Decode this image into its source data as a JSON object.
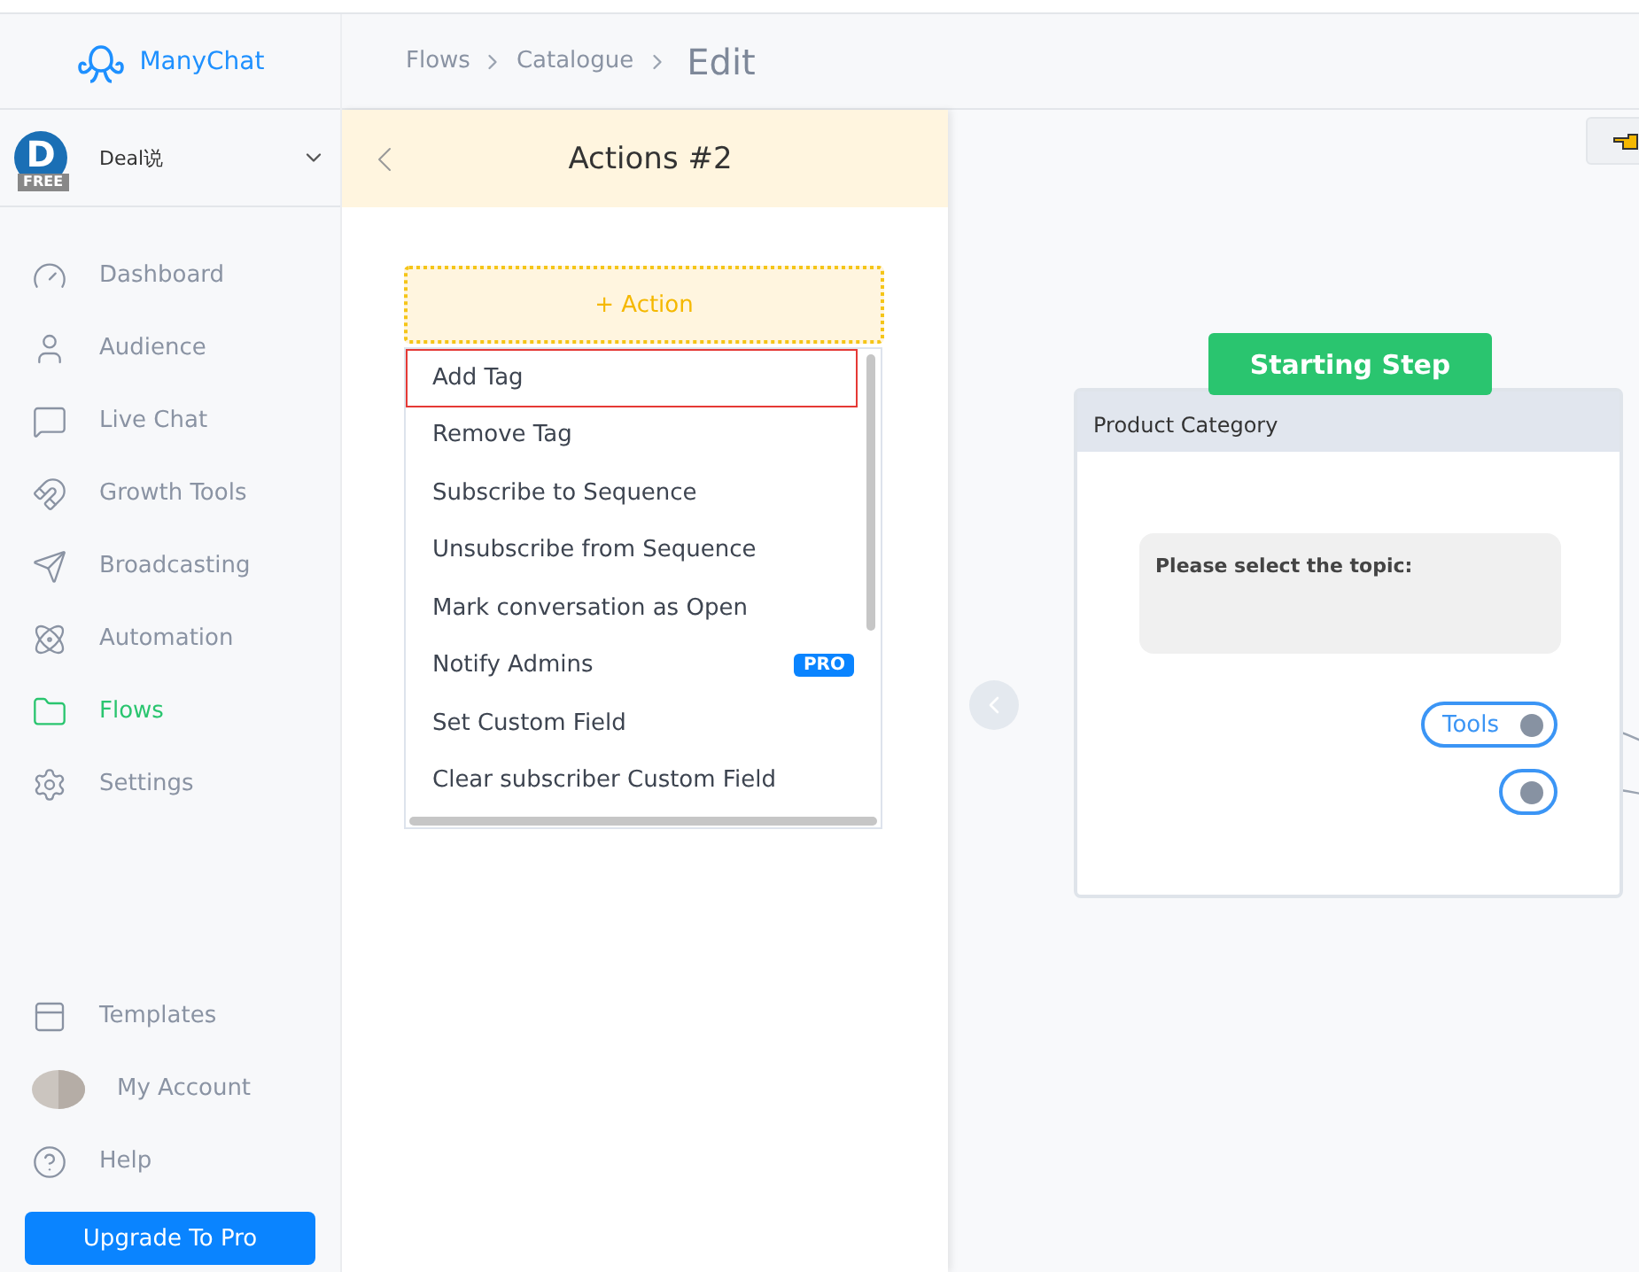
{
  "brand": {
    "name": "ManyChat"
  },
  "breadcrumb": {
    "items": [
      "Flows",
      "Catalogue"
    ],
    "current": "Edit"
  },
  "account": {
    "initial": "D",
    "plan": "FREE",
    "name": "Deal说"
  },
  "nav": [
    {
      "label": "Dashboard",
      "selected": false
    },
    {
      "label": "Audience",
      "selected": false
    },
    {
      "label": "Live Chat",
      "selected": false
    },
    {
      "label": "Growth Tools",
      "selected": false
    },
    {
      "label": "Broadcasting",
      "selected": false
    },
    {
      "label": "Automation",
      "selected": false
    },
    {
      "label": "Flows",
      "selected": true
    },
    {
      "label": "Settings",
      "selected": false
    }
  ],
  "bottom_nav": [
    {
      "label": "Templates"
    },
    {
      "label": "My Account"
    },
    {
      "label": "Help"
    }
  ],
  "upgrade_button": "Upgrade To Pro",
  "panel": {
    "title": "Actions #2",
    "add_button": "+ Action",
    "menu": [
      {
        "label": "Add Tag",
        "selected": true
      },
      {
        "label": "Remove Tag",
        "selected": false
      },
      {
        "label": "Subscribe to Sequence",
        "selected": false
      },
      {
        "label": "Unsubscribe from Sequence",
        "selected": false
      },
      {
        "label": "Mark conversation as Open",
        "selected": false
      },
      {
        "label": "Notify Admins",
        "selected": false,
        "badge": "PRO"
      },
      {
        "label": "Set Custom Field",
        "selected": false
      },
      {
        "label": "Clear subscriber Custom Field",
        "selected": false
      }
    ]
  },
  "canvas": {
    "start_label": "Starting Step",
    "node": {
      "title": "Product Category",
      "message": "Please select the topic:",
      "buttons": [
        {
          "kind": "text",
          "label": "Tools"
        },
        {
          "kind": "blank"
        }
      ]
    }
  }
}
